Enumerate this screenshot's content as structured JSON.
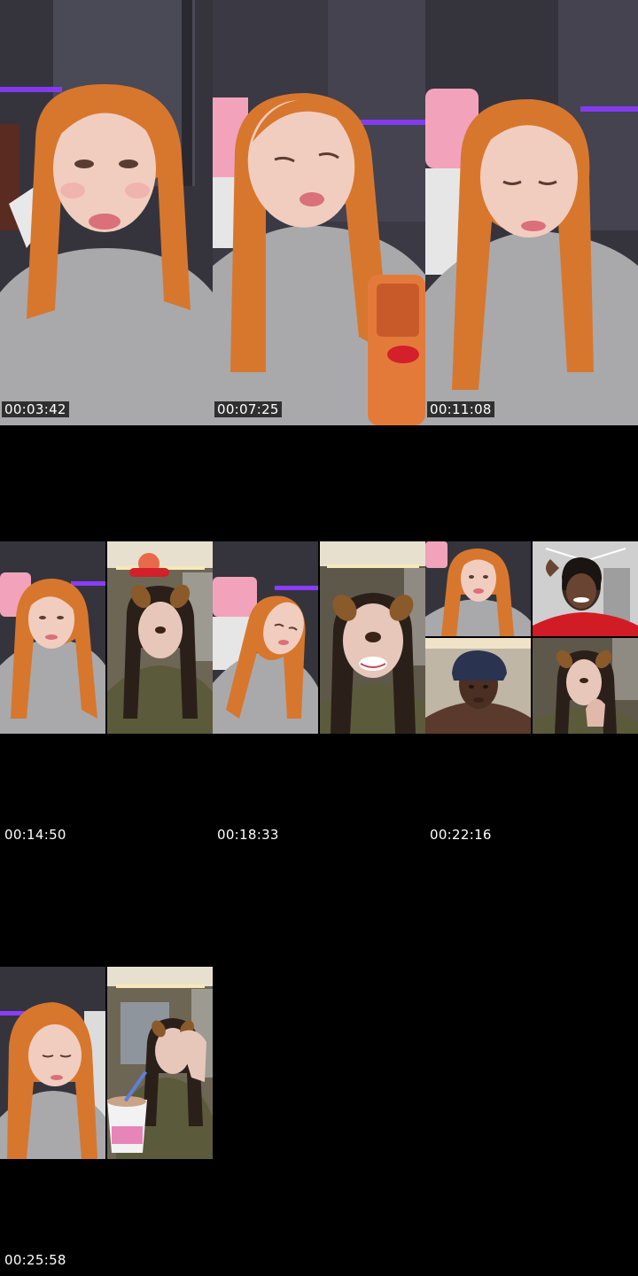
{
  "contact_sheet": {
    "frames": [
      {
        "timestamp": "00:03:42",
        "layout": "single"
      },
      {
        "timestamp": "00:07:25",
        "layout": "single"
      },
      {
        "timestamp": "00:11:08",
        "layout": "single"
      },
      {
        "timestamp": "00:14:50",
        "layout": "split-2"
      },
      {
        "timestamp": "00:18:33",
        "layout": "split-2"
      },
      {
        "timestamp": "00:22:16",
        "layout": "grid-4"
      },
      {
        "timestamp": "00:25:58",
        "layout": "split-2"
      }
    ]
  },
  "colors": {
    "background": "#000000",
    "hair": "#d7772e",
    "sweater": "#a9a9ab",
    "skin": "#f1cdbf",
    "neon": "#8a3cff",
    "wall": "#3a3944",
    "olive_shirt": "#5b5a3a",
    "red_shirt": "#d11c26"
  }
}
